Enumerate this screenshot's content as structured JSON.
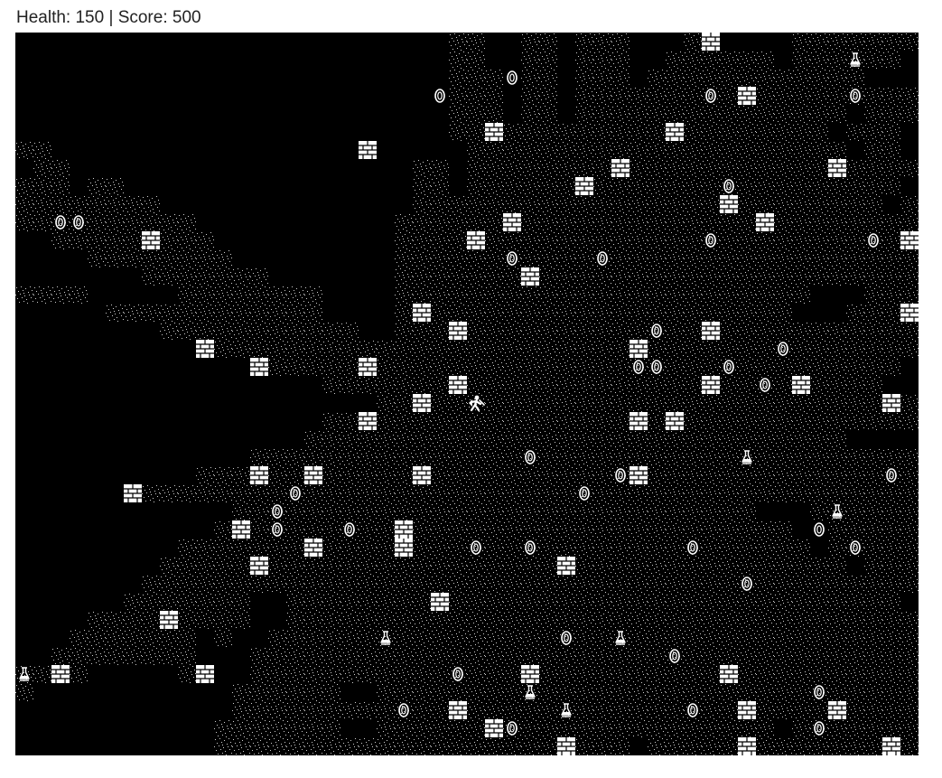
{
  "hud": {
    "health_label": "Health:",
    "health_value": "150",
    "separator": "|",
    "score_label": "Score:",
    "score_value": "500"
  },
  "game": {
    "grid_cols": 50,
    "grid_rows": 40,
    "colors": {
      "background": "#000000",
      "floor_dots": "#cfcfcf",
      "wall": "#ffffff",
      "item": "#ffffff",
      "player": "#ffffff"
    },
    "tile_icons": {
      "floor": "gravel-floor-tile",
      "wall": "brick-wall-icon",
      "coin": "gold-coin-icon",
      "potion": "potion-flask-icon",
      "player": "adventurer-player-icon"
    },
    "floor_rows": [
      "........................XX..XX.XXX...X.....XXXXXXX",
      "........................XX..XX.XXX..XXXXXX.XXXXXX.",
      "........................XXX.XX.XXX.XXXXXXXXXXXX...",
      "........................XXX.XX.XXXXXXXXXXXXXXXXXXX",
      "........................XXX.XX.XXXXXXXXXXXXXXX.XXX",
      "........................XXXXXXXXXXXXXXXXXXXXX.XXX.",
      "XX.......................XXXXXXXXXXXXXXXXXXXXX.XX.",
      ".XX...................XX.XXXXXXXXXXXXXXXXXXXXXXXXX",
      "XXX.XX................XX.XXXXXXXXXXXXXXXXXXXXXXXX.",
      "XXXXXXXX..............XXXXXXXXXXXXXXXXXXXXXXXXXX.X",
      "XXXXXXXXXX...........XXXXXXXXXXXXXXXXXXXXXXXXXXXXX",
      "..XXXXXXXXX..........XXXXXXXXXXXXXXXXXXXXXXXXXXXXX",
      "....XXXXXXXX.........XXXXXXXXXXXXXXXXXXXXXXXXXXXXX",
      ".......XXXXXXX.......XXXXXXXXXXXXXXXXXXXXXXXXXXXXX",
      "XXXX.....XXXXXXXX....XXXXXXXXXXXXXXXXXXXXXXX...XXX",
      ".....XXXXXXXXXXXX....XXXXXXXXXXXXXXXXXXXXXX...XXXX",
      "........XXXXXXXXXXX..XXXXXXXXXXXXXXXXXXXXXXXXXXXXX",
      "...........XXXXXXXXXXXXXXXXXXXXXXXXXXXXXXXXXXXXXXX",
      ".............XXXXXXXXXXXXXXXXXXXXXXXXXXXXXXXXXXXX.",
      ".................XXXXXXXXXXXXXXXXXXXXXXXXXXXXXXX..",
      "....................XXXXXXXXXXXXXXXXXXXXXXXXXXXXXX",
      ".................XXXXXXXXXXXXXXXXXXXXXXXXXXXXXXXXX",
      "................XXXXXXXXXXXXXXXXXXXXXXXXXXXXXX....",
      ".............XXXXXXXXXXXXXXXXXXXXXXXXXXXXXXXXXXXXX",
      "..........XXXXXXXXXXXXXXXXXXXXXXXXXXXXXXXXXXXXXXXX",
      "......XXXXXXXXXXXXXXXXXXXXXXXXXXXXXXXXXXXXXXXXXXXX",
      "............XXXXXXXXXXXXXXXXXXXXXXXXXXXXX...XXXXXX",
      "...........XXXXXXXXXXXXXXXXXXXXXXXXXXXXXXXX..XXXXX",
      ".........XXXXXXXXXXXXXXXXXXXXXXXXXXXXXXXXXXX.XXXXX",
      "........XXXXXXXXXXXXXXXXXXXXXXXXXXXXXXXXXXXXXX.XXX",
      ".......XXXXXXXXXXXXXXXXXXXXXXXXXXXXXXXXXXXXXXXXXXX",
      "......XXXXXXX..XXXXXXXXXXXXXXXXXXXXXXXXXXXXXXXXXX.",
      "....XXXXXXXXX..XXXXXXXXXXXXXXXXXXXXXXXXXXXXXXXXXXX",
      "...XXXXXXX.X..XXXXXXXXXXXXXXXXXXXXXXXXXXXXXXXXXXXX",
      "..XXXXXXXX...XXXXXXXXXXXXXXXXXXXXXXXXXXXXXXXXXXXXX",
      "XXXX.....XX..XXXXXXXXXXXXXXXXXXXXXXXXXXXXXXXXXXXXX",
      "X...........XXXXXX..XXXXXXXXXXXXXXXXXXXXXXXXXXXXXX",
      "............XXXXXXXXXXXXXXXXXXXXXXXXXXXXXXXXXXXXXX",
      "...........XXXXXXX..XXXXXXXXXXXXXXXXXXXXXX.XXXXXXX",
      "...........XXXXXXXXXXXXXXXXXXXXXXX.XXXXXXXXXXXXXXX"
    ],
    "walls": [
      [
        38,
        0
      ],
      [
        40,
        3
      ],
      [
        26,
        5
      ],
      [
        36,
        5
      ],
      [
        19,
        6
      ],
      [
        33,
        7
      ],
      [
        45,
        7
      ],
      [
        31,
        8
      ],
      [
        39,
        9
      ],
      [
        27,
        10
      ],
      [
        41,
        10
      ],
      [
        25,
        11
      ],
      [
        49,
        11
      ],
      [
        7,
        11
      ],
      [
        28,
        13
      ],
      [
        22,
        15
      ],
      [
        49,
        15
      ],
      [
        24,
        16
      ],
      [
        38,
        16
      ],
      [
        34,
        17
      ],
      [
        10,
        17
      ],
      [
        13,
        18
      ],
      [
        19,
        18
      ],
      [
        24,
        19
      ],
      [
        38,
        19
      ],
      [
        43,
        19
      ],
      [
        22,
        20
      ],
      [
        48,
        20
      ],
      [
        19,
        21
      ],
      [
        34,
        21
      ],
      [
        36,
        21
      ],
      [
        13,
        24
      ],
      [
        16,
        24
      ],
      [
        22,
        24
      ],
      [
        34,
        24
      ],
      [
        6,
        25
      ],
      [
        12,
        27
      ],
      [
        21,
        27
      ],
      [
        21,
        28
      ],
      [
        16,
        28
      ],
      [
        13,
        29
      ],
      [
        30,
        29
      ],
      [
        23,
        31
      ],
      [
        8,
        32
      ],
      [
        2,
        35
      ],
      [
        10,
        35
      ],
      [
        28,
        35
      ],
      [
        39,
        35
      ],
      [
        24,
        37
      ],
      [
        40,
        37
      ],
      [
        45,
        37
      ],
      [
        26,
        38
      ],
      [
        30,
        39
      ],
      [
        40,
        39
      ],
      [
        48,
        39
      ]
    ],
    "coins": [
      [
        27,
        2
      ],
      [
        23,
        3
      ],
      [
        38,
        3
      ],
      [
        46,
        3
      ],
      [
        39,
        8
      ],
      [
        2,
        10
      ],
      [
        3,
        10
      ],
      [
        38,
        11
      ],
      [
        47,
        11
      ],
      [
        27,
        12
      ],
      [
        32,
        12
      ],
      [
        35,
        16
      ],
      [
        42,
        17
      ],
      [
        34,
        18
      ],
      [
        35,
        18
      ],
      [
        39,
        18
      ],
      [
        41,
        19
      ],
      [
        28,
        23
      ],
      [
        33,
        24
      ],
      [
        48,
        24
      ],
      [
        15,
        25
      ],
      [
        31,
        25
      ],
      [
        14,
        26
      ],
      [
        14,
        27
      ],
      [
        18,
        27
      ],
      [
        44,
        27
      ],
      [
        25,
        28
      ],
      [
        28,
        28
      ],
      [
        37,
        28
      ],
      [
        46,
        28
      ],
      [
        40,
        30
      ],
      [
        30,
        33
      ],
      [
        36,
        34
      ],
      [
        24,
        35
      ],
      [
        44,
        36
      ],
      [
        21,
        37
      ],
      [
        37,
        37
      ],
      [
        27,
        38
      ],
      [
        44,
        38
      ]
    ],
    "potions": [
      [
        46,
        1
      ],
      [
        40,
        23
      ],
      [
        45,
        26
      ],
      [
        20,
        33
      ],
      [
        33,
        33
      ],
      [
        0,
        35
      ],
      [
        28,
        36
      ],
      [
        30,
        37
      ]
    ],
    "player": [
      25,
      20
    ]
  }
}
